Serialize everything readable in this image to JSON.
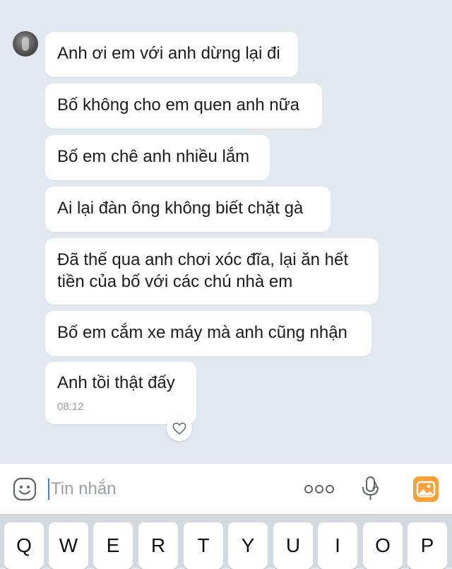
{
  "chat": {
    "messages": [
      {
        "text": "Anh ơi em với anh dừng lại đi"
      },
      {
        "text": "Bố không cho em quen anh nữa"
      },
      {
        "text": "Bố em chê anh nhiều lắm"
      },
      {
        "text": "Ai lại đàn ông không biết chặt gà"
      },
      {
        "line1": "Đã thế qua anh chơi xóc đĩa, lại ăn hết",
        "line2": "tiền của bố với các chú nhà em"
      },
      {
        "text": "Bố em cắm xe máy mà anh cũng nhận"
      },
      {
        "text": "Anh tồi thật đấy",
        "time": "08:12"
      }
    ]
  },
  "input": {
    "placeholder": "Tin nhắn",
    "icons": [
      "emoji-icon",
      "more-icon",
      "mic-icon",
      "gallery-icon"
    ]
  },
  "keyboard": {
    "keys": [
      "Q",
      "W",
      "E",
      "R",
      "T",
      "Y",
      "U",
      "I",
      "O",
      "P"
    ]
  },
  "colors": {
    "chat_background": "#e2e8f0",
    "bubble": "#ffffff",
    "gallery_accent": "#f6a23a",
    "caret": "#3b82f6"
  }
}
